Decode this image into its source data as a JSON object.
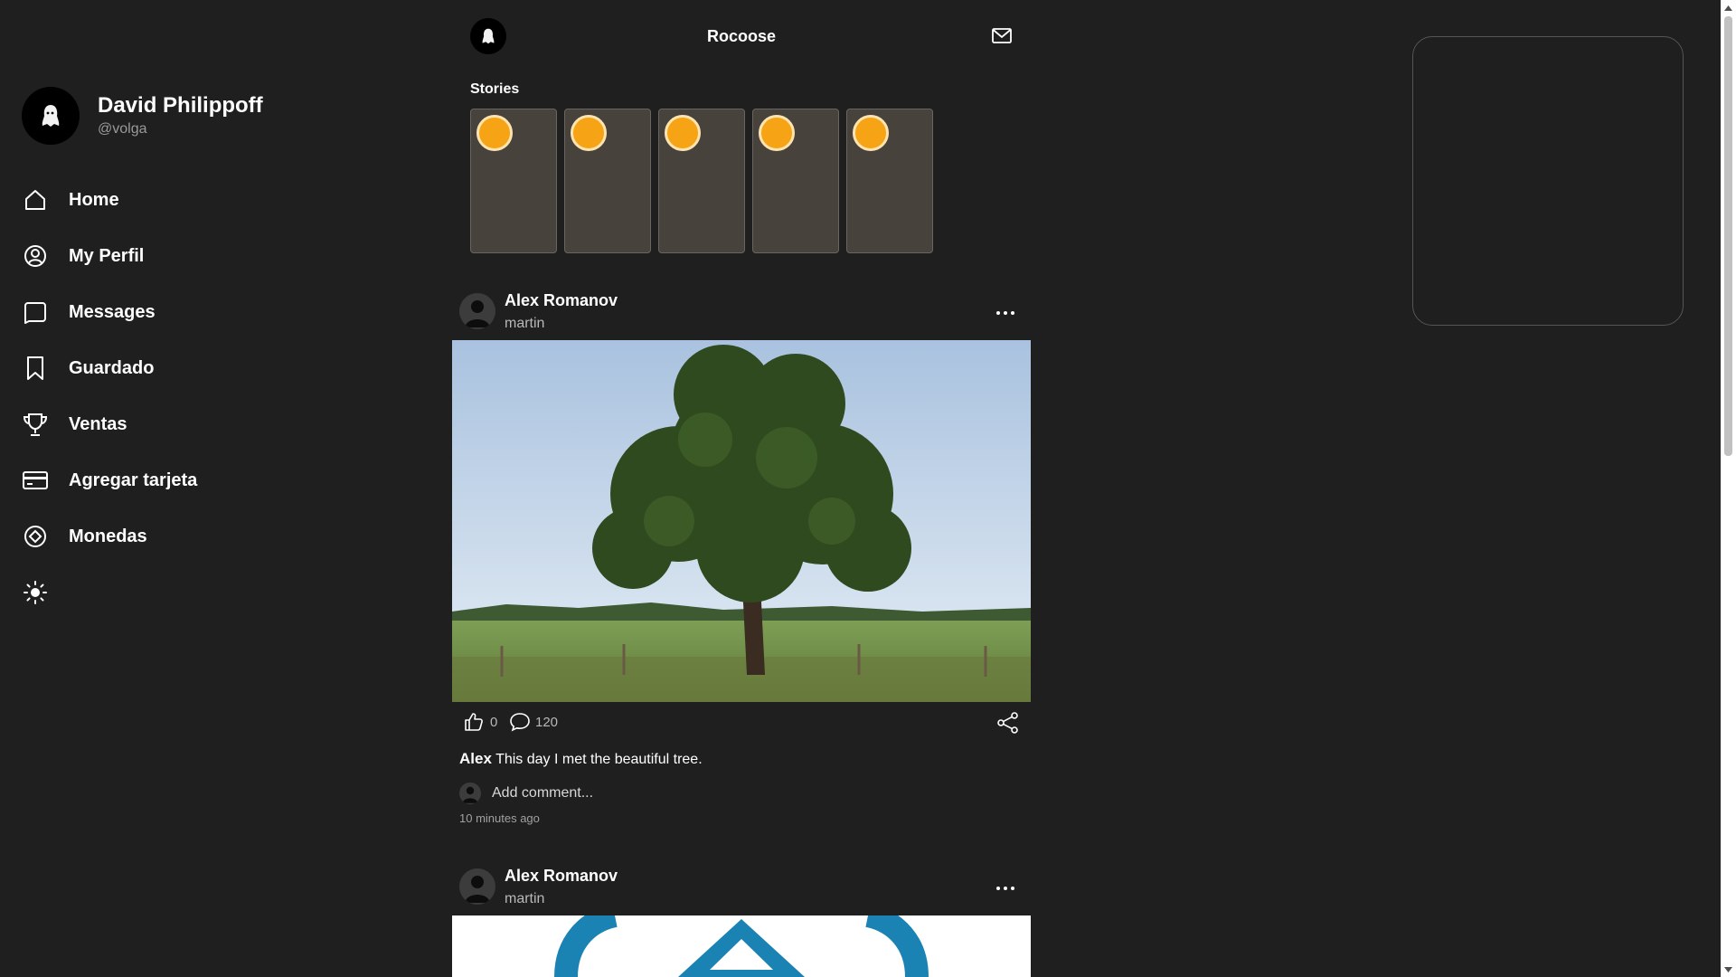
{
  "app": {
    "title": "Rocoose"
  },
  "profile": {
    "name": "David Philippoff",
    "handle": "@volga"
  },
  "nav": [
    {
      "label": "Home",
      "icon": "home-icon"
    },
    {
      "label": "My Perfil",
      "icon": "user-circle-icon"
    },
    {
      "label": "Messages",
      "icon": "chat-bubble-icon"
    },
    {
      "label": "Guardado",
      "icon": "bookmark-icon"
    },
    {
      "label": "Ventas",
      "icon": "trophy-icon"
    },
    {
      "label": "Agregar tarjeta",
      "icon": "credit-card-icon"
    },
    {
      "label": "Monedas",
      "icon": "coin-icon"
    }
  ],
  "theme_toggle_icon": "sun-icon",
  "stories": {
    "title": "Stories",
    "count": 5,
    "ring_color": "#f6a315"
  },
  "posts": [
    {
      "author": "Alex Romanov",
      "subtitle": "martin",
      "likes": "0",
      "comments": "120",
      "caption_author": "Alex",
      "caption_text": "This day I met the beautiful tree.",
      "comment_placeholder": "Add comment...",
      "time": "10 minutes ago",
      "image": "tree-photo"
    },
    {
      "author": "Alex Romanov",
      "subtitle": "martin",
      "image": "blue-logo-image"
    }
  ],
  "colors": {
    "background": "#1f1f1f",
    "story_card": "#48423d",
    "accent": "#f6a315"
  }
}
